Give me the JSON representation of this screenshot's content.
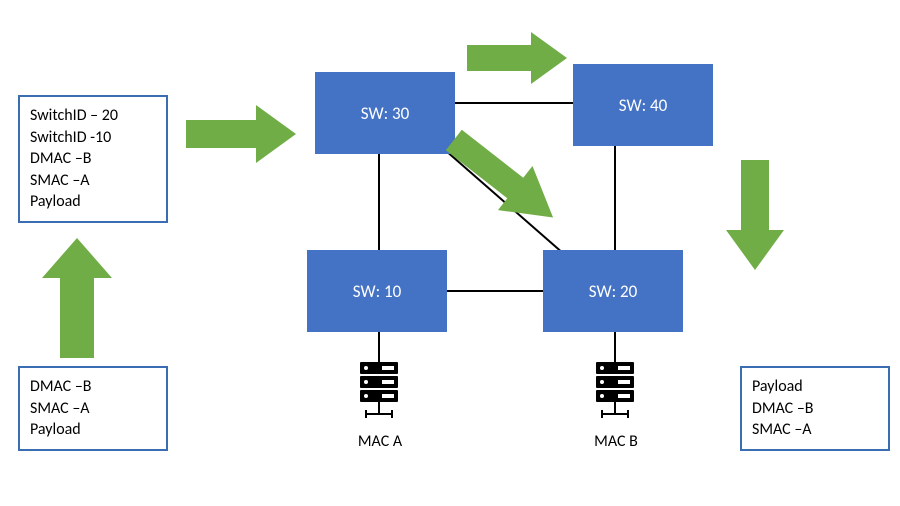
{
  "packet_top": {
    "line1": "SwitchID – 20",
    "line2": "SwitchID -10",
    "line3": "DMAC –B",
    "line4": "SMAC –A",
    "line5": "Payload"
  },
  "packet_bottom": {
    "line1": "DMAC –B",
    "line2": "SMAC –A",
    "line3": "Payload"
  },
  "packet_right": {
    "line1": "Payload",
    "line2": "DMAC –B",
    "line3": "SMAC –A"
  },
  "switches": {
    "sw30": "SW: 30",
    "sw40": "SW: 40",
    "sw10": "SW: 10",
    "sw20": "SW: 20"
  },
  "hosts": {
    "macA": "MAC A",
    "macB": "MAC B"
  },
  "colors": {
    "arrow": "#70ad47",
    "switch": "#4472c4",
    "box_border": "#3b6db3"
  }
}
